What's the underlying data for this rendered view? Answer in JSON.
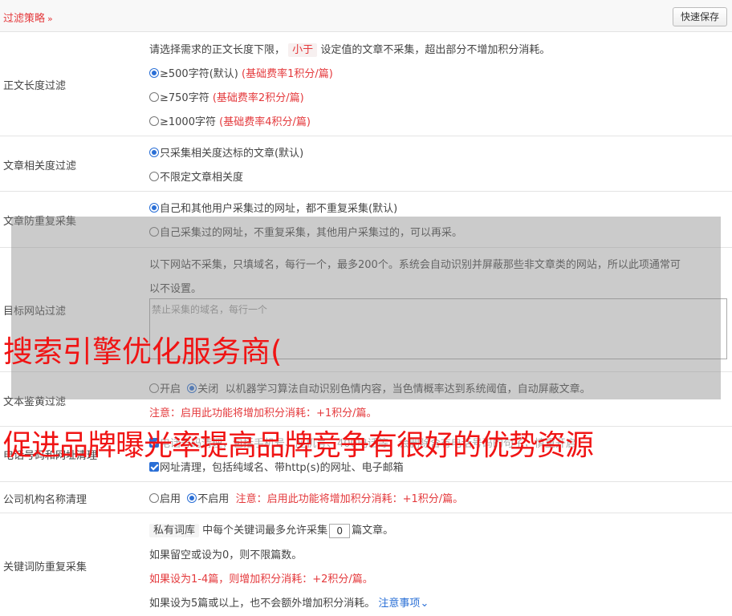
{
  "header": {
    "title": "过滤策略",
    "chevron": "»",
    "save_label": "快速保存"
  },
  "length_filter": {
    "label": "正文长度过滤",
    "intro_pre": "请选择需求的正文长度下限，",
    "intro_pill": "小于",
    "intro_post": "设定值的文章不采集，超出部分不增加积分消耗。",
    "options": [
      {
        "label": "≥500字符(默认)",
        "note": "(基础费率1积分/篇)",
        "selected": true
      },
      {
        "label": "≥750字符",
        "note": "(基础费率2积分/篇)",
        "selected": false
      },
      {
        "label": "≥1000字符",
        "note": "(基础费率4积分/篇)",
        "selected": false
      }
    ]
  },
  "relevance_filter": {
    "label": "文章相关度过滤",
    "options": [
      {
        "label": "只采集相关度达标的文章(默认)",
        "selected": true
      },
      {
        "label": "不限定文章相关度",
        "selected": false
      }
    ]
  },
  "dedupe": {
    "label": "文章防重复采集",
    "options": [
      {
        "label": "自己和其他用户采集过的网址，都不重复采集(默认)",
        "selected": true
      },
      {
        "label": "自己采集过的网址，不重复采集，其他用户采集过的，可以再采。",
        "selected": false
      }
    ]
  },
  "site_filter": {
    "label": "目标网站过滤",
    "desc_line1": "以下网站不采集，只填域名，每行一个，最多200个。系统会自动识别并屏蔽那些非文章类的网站，所以此项通常可",
    "desc_line2": "以不设置。",
    "placeholder": "禁止采集的域名，每行一个"
  },
  "porn_filter": {
    "label": "文本鉴黄过滤",
    "on_label": "开启",
    "off_label": "关闭",
    "desc": "以机器学习算法自动识别色情内容，当色情概率达到系统阈值，自动屏蔽文章。",
    "note": "注意：启用此功能将增加积分消耗：+1积分/篇。"
  },
  "contact_clean": {
    "label": "电话号码和网址清理",
    "line1": "电话号码清理，包括手机号、座机号、400电话等，会删除含有电话号码的句子，慎重开启",
    "line2": "网址清理，包括纯域名、带http(s)的网址、电子邮箱"
  },
  "org_clean": {
    "label": "公司机构名称清理",
    "on_label": "启用",
    "off_label": "不启用",
    "note": "注意：启用此功能将增加积分消耗：+1积分/篇。"
  },
  "keyword_dedupe": {
    "label": "关键词防重复采集",
    "pill": "私有词库",
    "pre": "中每个关键词最多允许采集",
    "value": "0",
    "post": "篇文章。",
    "line2": "如果留空或设为0，则不限篇数。",
    "line3": "如果设为1-4篇，则增加积分消耗：+2积分/篇。",
    "line4": "如果设为5篇或以上，也不会额外增加积分消耗。",
    "link": "注意事项"
  },
  "watermarks": {
    "line1": "搜索引擎优化服务商(",
    "line2": "促进品牌曝光率提高品牌竞争有很好的优势资源"
  }
}
